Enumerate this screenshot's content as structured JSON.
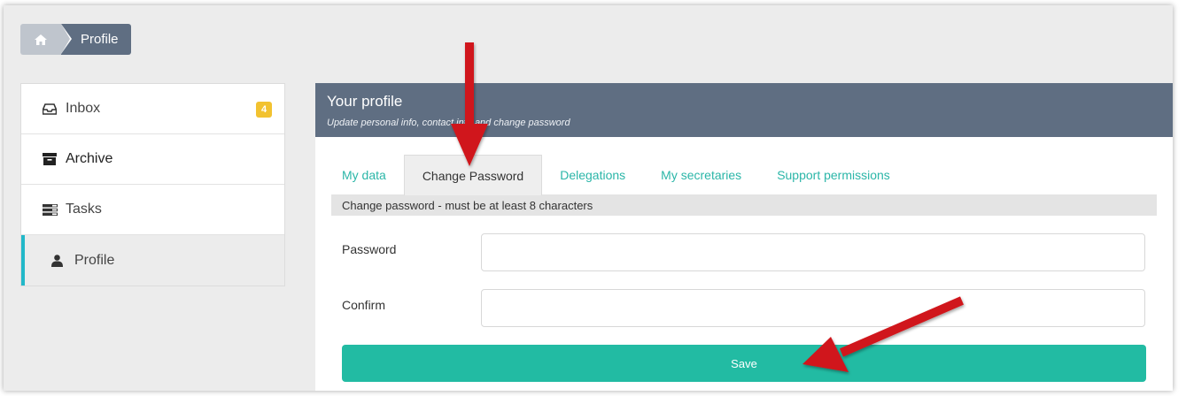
{
  "breadcrumb": {
    "home_icon": "home-icon",
    "current": "Profile"
  },
  "sidebar": {
    "items": [
      {
        "label": "Inbox",
        "icon": "inbox-icon",
        "badge": "4"
      },
      {
        "label": "Archive",
        "icon": "archive-box-icon"
      },
      {
        "label": "Tasks",
        "icon": "tasks-icon"
      },
      {
        "label": "Profile",
        "icon": "user-icon",
        "active": true
      }
    ]
  },
  "panel": {
    "title": "Your profile",
    "subtitle": "Update personal info, contact info and change password"
  },
  "tabs": [
    {
      "label": "My data"
    },
    {
      "label": "Change Password",
      "active": true
    },
    {
      "label": "Delegations"
    },
    {
      "label": "My secretaries"
    },
    {
      "label": "Support permissions"
    }
  ],
  "form": {
    "notice": "Change password - must be at least 8 characters",
    "password_label": "Password",
    "password_value": "",
    "confirm_label": "Confirm",
    "confirm_value": "",
    "save_label": "Save"
  },
  "colors": {
    "header": "#5f6e82",
    "accent": "#22bba3",
    "tab_link": "#2bb6a8",
    "active_bar": "#22b8c9",
    "badge": "#f2c230",
    "annotation_arrow": "#d0161a"
  }
}
